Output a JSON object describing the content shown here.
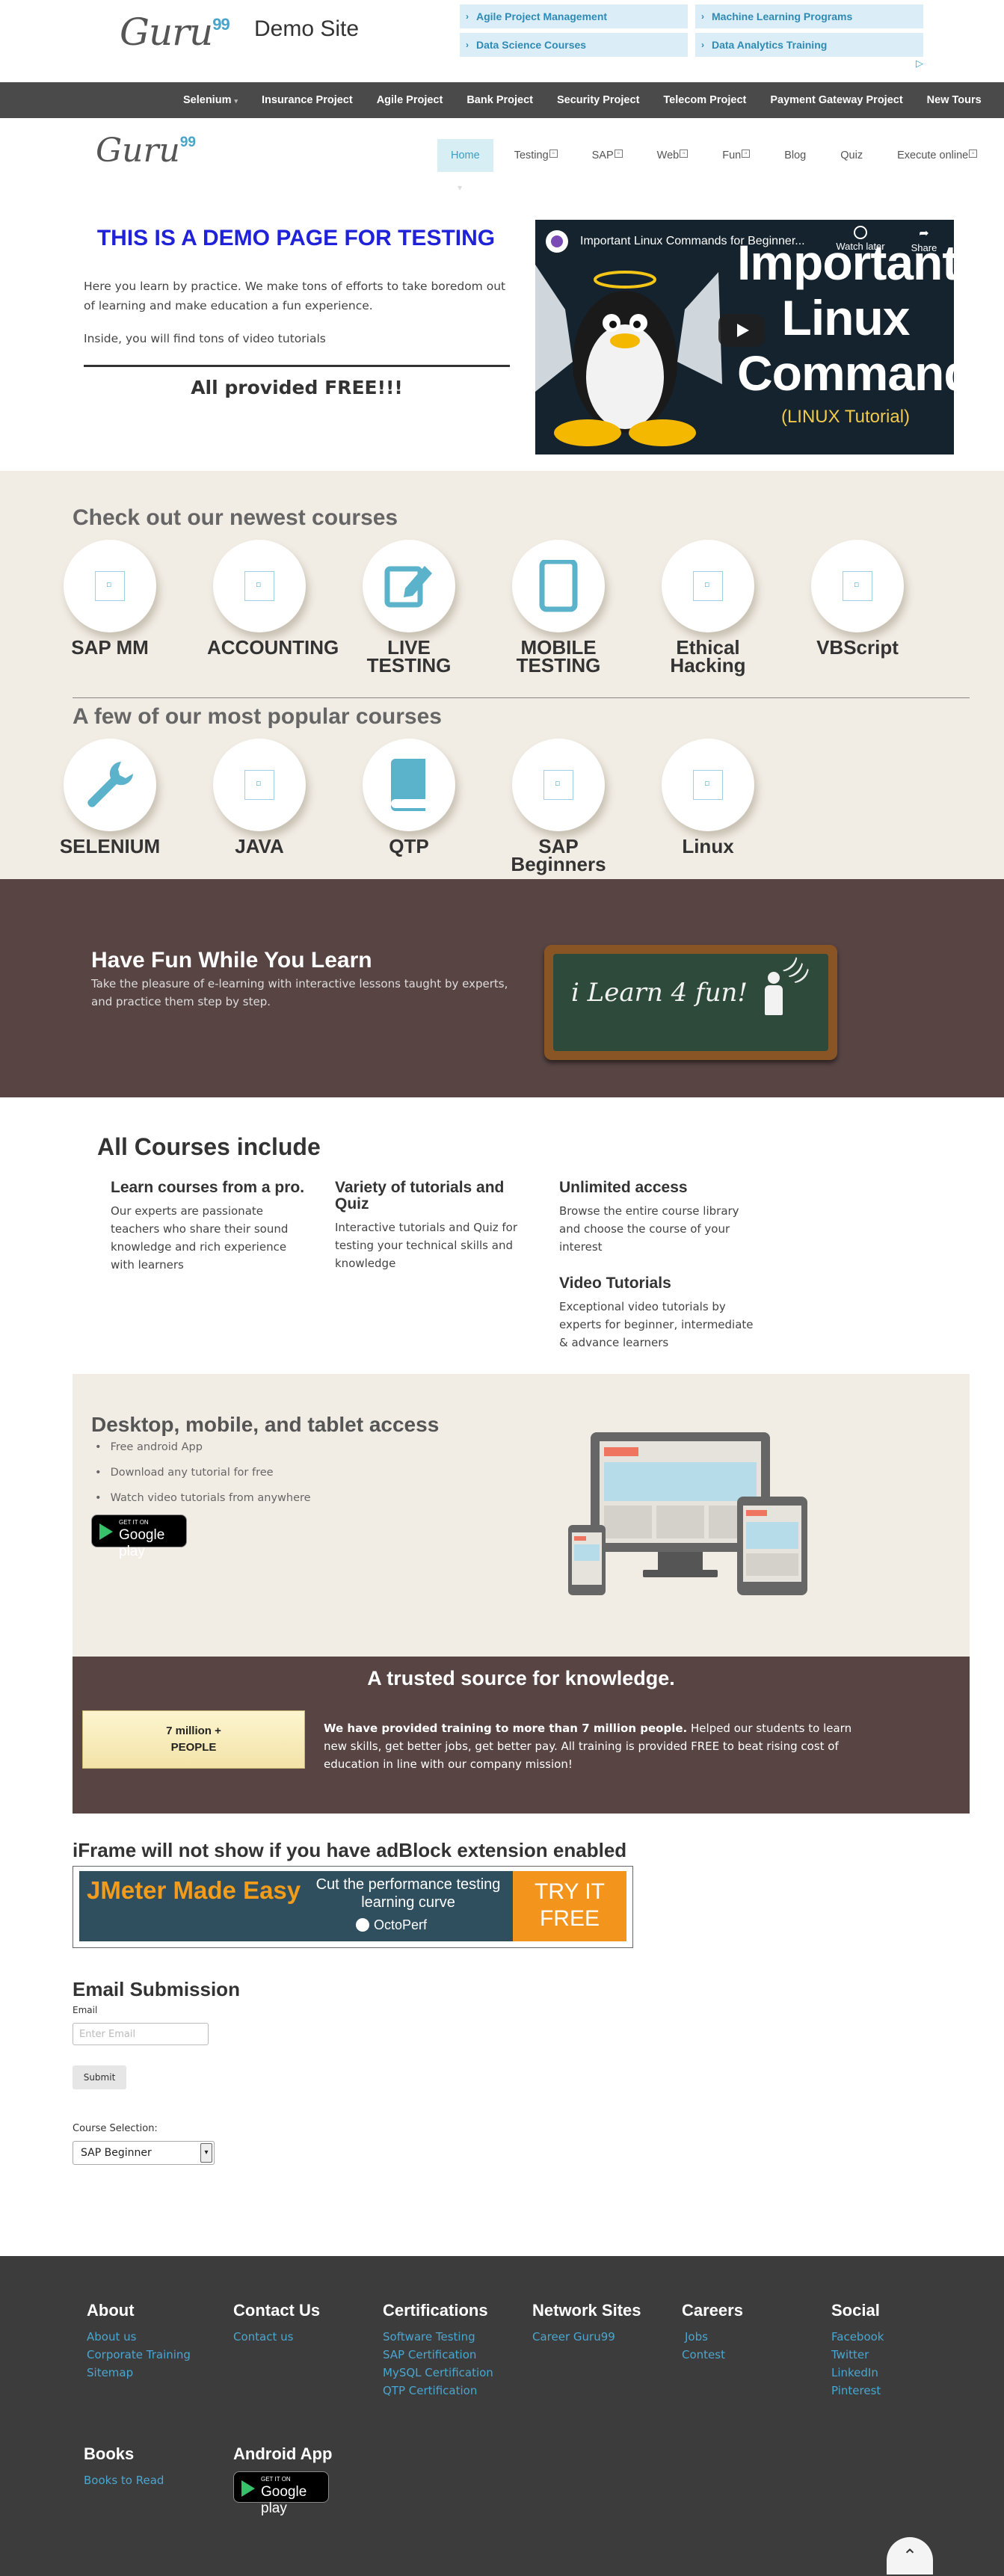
{
  "header": {
    "logo": "Guru",
    "logo_sup": "99",
    "site_title": "Demo Site",
    "ad_links": [
      "Agile Project Management",
      "Machine Learning Programs",
      "Data Science Courses",
      "Data Analytics Training"
    ],
    "ad_marker": "▷"
  },
  "dark_nav": {
    "items": [
      "Selenium",
      "Insurance Project",
      "Agile Project",
      "Bank Project",
      "Security Project",
      "Telecom Project",
      "Payment Gateway Project",
      "New Tours"
    ],
    "caret": "▾"
  },
  "nav": {
    "logo": "Guru",
    "logo_sup": "99",
    "items": [
      "Home",
      "Testing",
      "SAP",
      "Web",
      "Fun",
      "Blog",
      "Quiz",
      "Execute online"
    ]
  },
  "hero": {
    "title": "THIS IS A DEMO PAGE FOR TESTING",
    "p1": "Here you learn by practice. We make tons of efforts to take boredom out of learning and make education a fun experience.",
    "p2": "Inside, you will find tons of video tutorials",
    "free": "All provided FREE!!!"
  },
  "video": {
    "title": "Important Linux Commands for Beginner...",
    "big_text": "Important Linux Commands",
    "sub_text": "(LINUX Tutorial)",
    "watch_later": "Watch later",
    "share": "Share"
  },
  "courses": {
    "newest_title": "Check out our newest courses",
    "newest": [
      {
        "name": "SAP MM",
        "icon": "placeholder-icon"
      },
      {
        "name": "ACCOUNTING",
        "icon": "placeholder-icon"
      },
      {
        "name": "LIVE TESTING",
        "icon": "edit-icon"
      },
      {
        "name": "MOBILE TESTING",
        "icon": "tablet-icon"
      },
      {
        "name": "Ethical Hacking",
        "icon": "placeholder-icon"
      },
      {
        "name": "VBScript",
        "icon": "placeholder-icon"
      }
    ],
    "popular_title": "A few of our most popular courses",
    "popular": [
      {
        "name": "SELENIUM",
        "icon": "wrench-icon"
      },
      {
        "name": "JAVA",
        "icon": "placeholder-icon"
      },
      {
        "name": "QTP",
        "icon": "book-icon"
      },
      {
        "name": "SAP Beginners",
        "icon": "placeholder-icon"
      },
      {
        "name": "Linux",
        "icon": "placeholder-icon"
      }
    ]
  },
  "fun": {
    "title": "Have Fun While You Learn",
    "text": "Take the pleasure of e-learning with interactive lessons taught by experts, and practice them step by step.",
    "board_text": "i Learn 4 fun!"
  },
  "include": {
    "title": "All Courses include",
    "features": [
      {
        "title": "Learn courses from a pro.",
        "text": "Our experts are passionate teachers who share their sound knowledge and rich experience with learners"
      },
      {
        "title": "Variety of tutorials and Quiz",
        "text": "Interactive tutorials and Quiz for testing your technical skills and knowledge"
      },
      {
        "title": "Unlimited access",
        "text": "Browse the entire course library and choose the course of your interest"
      },
      {
        "title": "Video Tutorials",
        "text": "Exceptional video tutorials by experts for beginner, intermediate & advance learners"
      }
    ]
  },
  "access": {
    "title": "Desktop, mobile, and tablet access",
    "items": [
      "Free android App",
      "Download any tutorial for free",
      "Watch video tutorials from anywhere"
    ],
    "gplay_small": "GET IT ON",
    "gplay_big": "Google play"
  },
  "trusted": {
    "title": "A trusted source for knowledge.",
    "box_line1": "7 million +",
    "box_line2": "PEOPLE",
    "text_bold": "We have provided training to more than 7 million people.",
    "text_rest": " Helped our students to learn new skills, get better jobs, get better pay. All training is provided FREE to beat rising cost of education in line with our company mission!"
  },
  "iframe": {
    "title": "iFrame will not show if you have adBlock extension enabled",
    "ad_title": "JMeter Made Easy",
    "ad_sub": "Cut the performance testing learning curve",
    "ad_brand": "OctoPerf",
    "ad_cta": "TRY IT FREE"
  },
  "form": {
    "title": "Email Submission",
    "email_label": "Email",
    "email_placeholder": "Enter Email",
    "submit": "Submit",
    "course_label": "Course Selection:",
    "course_value": "SAP Beginner"
  },
  "footer": {
    "columns": [
      {
        "title": "About",
        "links": [
          "About us",
          "Corporate Training",
          "Sitemap"
        ]
      },
      {
        "title": "Contact Us",
        "links": [
          "Contact us"
        ]
      },
      {
        "title": "Certifications",
        "links": [
          "Software Testing",
          "SAP Certification",
          "MySQL Certification",
          "QTP Certification"
        ]
      },
      {
        "title": "Network Sites",
        "links": [
          "Career Guru99"
        ]
      },
      {
        "title": "Careers",
        "links": [
          "Jobs",
          "Contest"
        ]
      },
      {
        "title": "Social",
        "links": [
          "Facebook",
          "Twitter",
          "LinkedIn",
          "Pinterest"
        ]
      },
      {
        "title": "Books",
        "links": [
          "Books to Read"
        ]
      },
      {
        "title": "Android App",
        "links": []
      }
    ],
    "to_top": "⌃"
  }
}
